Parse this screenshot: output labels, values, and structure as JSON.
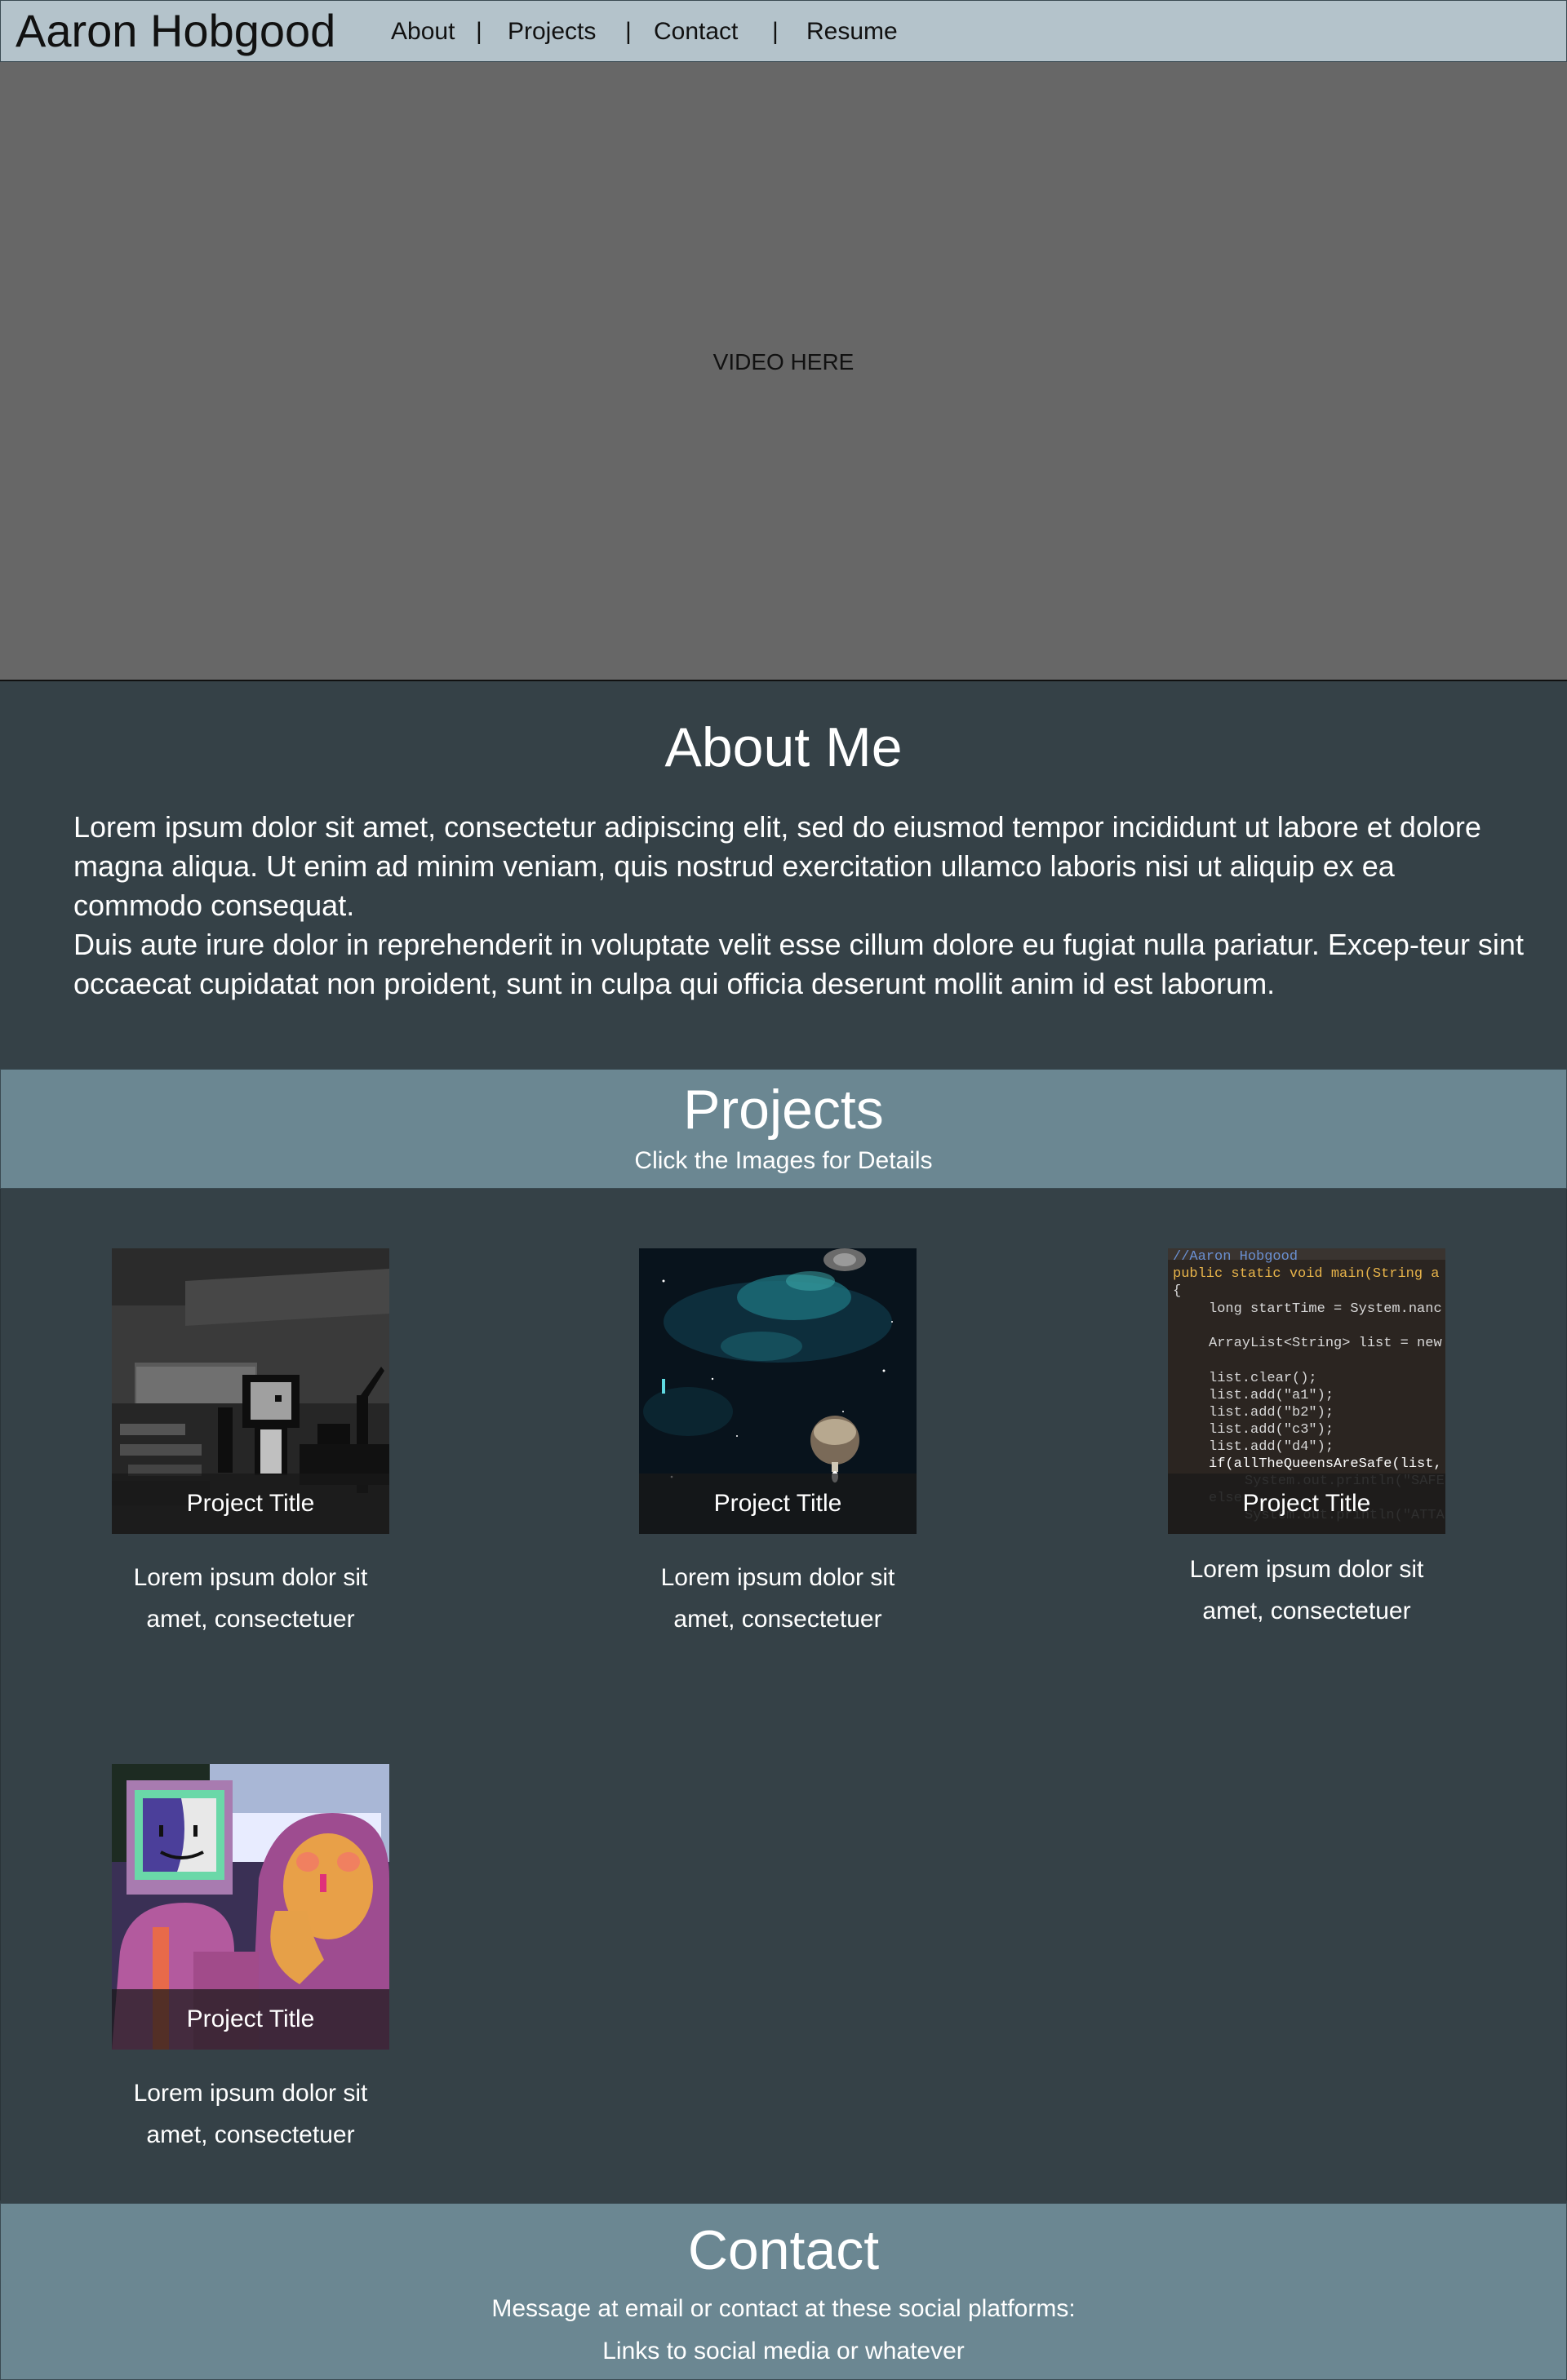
{
  "header": {
    "site_name": "Aaron Hobgood",
    "nav": [
      {
        "label": "About"
      },
      {
        "label": "Projects"
      },
      {
        "label": "Contact"
      },
      {
        "label": "Resume"
      }
    ],
    "separator": "|"
  },
  "video": {
    "label": "VIDEO HERE"
  },
  "about": {
    "title": "About Me",
    "paragraphs": [
      "Lorem ipsum dolor sit amet, consectetur adipiscing elit, sed do eiusmod tempor incididunt ut labore et dolore magna aliqua. Ut enim ad minim veniam, quis nostrud exercitation ullamco laboris nisi ut aliquip ex ea commodo consequat.",
      "Duis aute irure dolor in reprehenderit in voluptate velit esse cillum dolore eu fugiat nulla pariatur. Excep-teur sint occaecat cupidatat non proident, sunt in culpa qui officia deserunt mollit anim id est laborum."
    ]
  },
  "projects": {
    "title": "Projects",
    "subtitle": "Click the Images for Details",
    "items": [
      {
        "title": "Project Title",
        "desc_line1": "Lorem ipsum dolor sit",
        "desc_line2": "amet, consectetuer",
        "image": "classroom-robot-image"
      },
      {
        "title": "Project Title",
        "desc_line1": "Lorem ipsum dolor sit",
        "desc_line2": "amet, consectetuer",
        "image": "space-nebula-image"
      },
      {
        "title": "Project Title",
        "desc_line1": "Lorem ipsum dolor sit",
        "desc_line2": "amet, consectetuer",
        "image": "code-editor-image"
      },
      {
        "title": "Project Title",
        "desc_line1": "Lorem ipsum dolor sit",
        "desc_line2": "amet, consectetuer",
        "image": "monitor-head-characters-image"
      }
    ],
    "code_lines": [
      "//Aaron Hobgood",
      "public static void main(String a",
      "{",
      "long startTime = System.nanc",
      "ArrayList<String> list = new",
      "list.clear();",
      "list.add(\"a1\");",
      "list.add(\"b2\");",
      "list.add(\"c3\");",
      "list.add(\"d4\");",
      "if(allTheQueensAreSafe(list,",
      "System.out.println(\"SAFE",
      "else",
      "System.out.println(\"ATTA"
    ]
  },
  "contact": {
    "title": "Contact",
    "line1": "Message at email or contact at these social platforms:",
    "line2": "Links to social media or whatever"
  },
  "colors": {
    "header_bg": "#b4c3cb",
    "video_bg": "#676767",
    "section_dark": "#354147",
    "section_accent": "#6b8792"
  }
}
